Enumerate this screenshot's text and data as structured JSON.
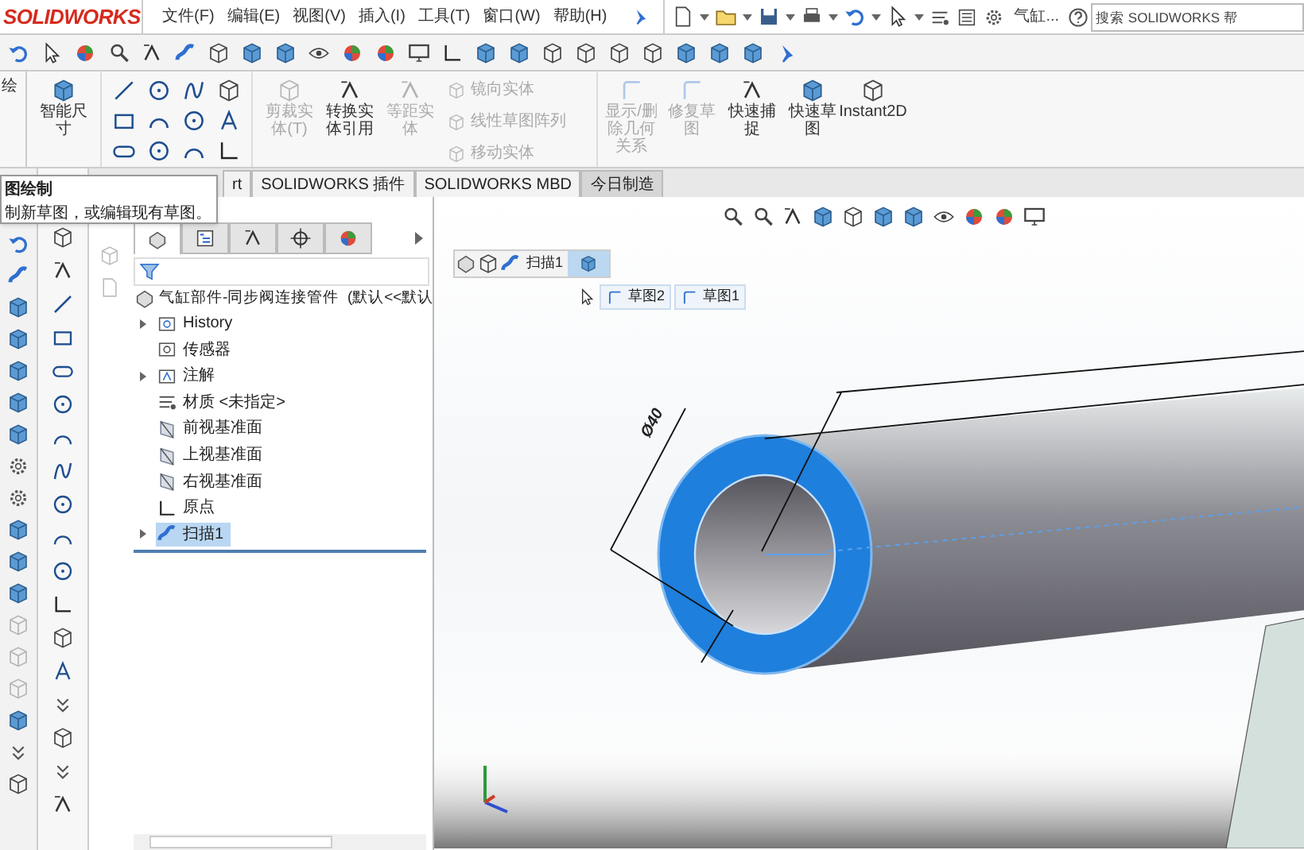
{
  "title_bar": {
    "logo": "SOLIDWORKS",
    "menus": [
      "文件(F)",
      "编辑(E)",
      "视图(V)",
      "插入(I)",
      "工具(T)",
      "窗口(W)",
      "帮助(H)"
    ],
    "document": "气缸...",
    "search": {
      "placeholder": "搜索 SOLIDWORKS 帮"
    }
  },
  "ribbon": {
    "buttons": [
      {
        "kind": "large",
        "label": "绘",
        "disabled": false
      },
      {
        "kind": "large",
        "label": "智能尺寸",
        "disabled": false
      },
      {
        "kind": "tools"
      },
      {
        "kind": "large",
        "label": "剪裁实体(T)",
        "disabled": true
      },
      {
        "kind": "large",
        "label": "转换实体引用",
        "disabled": false
      },
      {
        "kind": "large",
        "label": "等距实体",
        "disabled": true
      },
      {
        "kind": "stack",
        "items": [
          {
            "label": "镜向实体",
            "disabled": true
          },
          {
            "label": "线性草图阵列",
            "disabled": true
          },
          {
            "label": "移动实体",
            "disabled": true
          }
        ]
      },
      {
        "kind": "large",
        "label": "显示/删除几何关系",
        "disabled": true
      },
      {
        "kind": "large",
        "label": "修复草图",
        "disabled": true
      },
      {
        "kind": "large",
        "label": "快速捕捉",
        "disabled": false
      },
      {
        "kind": "large",
        "label": "快速草图",
        "disabled": false
      },
      {
        "kind": "large",
        "label": "Instant2D",
        "disabled": false
      }
    ]
  },
  "command_tabs": [
    {
      "label": "rt",
      "selected": false
    },
    {
      "label": "SOLIDWORKS 插件",
      "selected": false
    },
    {
      "label": "SOLIDWORKS MBD",
      "selected": false
    },
    {
      "label": "今日制造",
      "selected": true
    }
  ],
  "tooltip": {
    "title": "图绘制",
    "text": "制新草图，或编辑现有草图。"
  },
  "feature_manager": {
    "tabs": [
      {
        "selected": true
      },
      {
        "selected": false
      },
      {
        "selected": false
      },
      {
        "selected": false
      },
      {
        "selected": false
      }
    ],
    "root": "气缸部件-同步阀连接管件  (默认<<默认",
    "items": [
      {
        "label": "History",
        "collapsed": true,
        "selected": false
      },
      {
        "label": "传感器",
        "collapsed": false,
        "selected": false
      },
      {
        "label": "注解",
        "collapsed": true,
        "selected": false
      },
      {
        "label": "材质 <未指定>",
        "collapsed": false,
        "selected": false
      },
      {
        "label": "前视基准面",
        "collapsed": false,
        "selected": false
      },
      {
        "label": "上视基准面",
        "collapsed": false,
        "selected": false
      },
      {
        "label": "右视基准面",
        "collapsed": false,
        "selected": false
      },
      {
        "label": "原点",
        "collapsed": false,
        "selected": false
      },
      {
        "label": "扫描1",
        "collapsed": true,
        "selected": true
      }
    ]
  },
  "breadcrumb": {
    "label": "扫描1",
    "sketches": [
      "草图2",
      "草图1"
    ]
  },
  "viewport": {
    "dimension": "Ø40"
  }
}
